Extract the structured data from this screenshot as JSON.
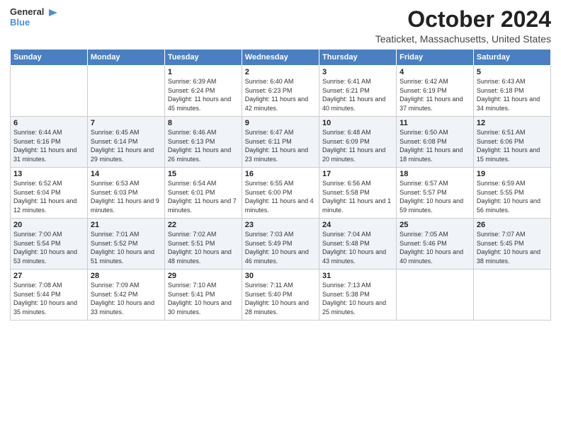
{
  "logo": {
    "line1": "General",
    "line2": "Blue"
  },
  "title": "October 2024",
  "location": "Teaticket, Massachusetts, United States",
  "headers": [
    "Sunday",
    "Monday",
    "Tuesday",
    "Wednesday",
    "Thursday",
    "Friday",
    "Saturday"
  ],
  "weeks": [
    [
      {
        "day": "",
        "info": ""
      },
      {
        "day": "",
        "info": ""
      },
      {
        "day": "1",
        "info": "Sunrise: 6:39 AM\nSunset: 6:24 PM\nDaylight: 11 hours and 45 minutes."
      },
      {
        "day": "2",
        "info": "Sunrise: 6:40 AM\nSunset: 6:23 PM\nDaylight: 11 hours and 42 minutes."
      },
      {
        "day": "3",
        "info": "Sunrise: 6:41 AM\nSunset: 6:21 PM\nDaylight: 11 hours and 40 minutes."
      },
      {
        "day": "4",
        "info": "Sunrise: 6:42 AM\nSunset: 6:19 PM\nDaylight: 11 hours and 37 minutes."
      },
      {
        "day": "5",
        "info": "Sunrise: 6:43 AM\nSunset: 6:18 PM\nDaylight: 11 hours and 34 minutes."
      }
    ],
    [
      {
        "day": "6",
        "info": "Sunrise: 6:44 AM\nSunset: 6:16 PM\nDaylight: 11 hours and 31 minutes."
      },
      {
        "day": "7",
        "info": "Sunrise: 6:45 AM\nSunset: 6:14 PM\nDaylight: 11 hours and 29 minutes."
      },
      {
        "day": "8",
        "info": "Sunrise: 6:46 AM\nSunset: 6:13 PM\nDaylight: 11 hours and 26 minutes."
      },
      {
        "day": "9",
        "info": "Sunrise: 6:47 AM\nSunset: 6:11 PM\nDaylight: 11 hours and 23 minutes."
      },
      {
        "day": "10",
        "info": "Sunrise: 6:48 AM\nSunset: 6:09 PM\nDaylight: 11 hours and 20 minutes."
      },
      {
        "day": "11",
        "info": "Sunrise: 6:50 AM\nSunset: 6:08 PM\nDaylight: 11 hours and 18 minutes."
      },
      {
        "day": "12",
        "info": "Sunrise: 6:51 AM\nSunset: 6:06 PM\nDaylight: 11 hours and 15 minutes."
      }
    ],
    [
      {
        "day": "13",
        "info": "Sunrise: 6:52 AM\nSunset: 6:04 PM\nDaylight: 11 hours and 12 minutes."
      },
      {
        "day": "14",
        "info": "Sunrise: 6:53 AM\nSunset: 6:03 PM\nDaylight: 11 hours and 9 minutes."
      },
      {
        "day": "15",
        "info": "Sunrise: 6:54 AM\nSunset: 6:01 PM\nDaylight: 11 hours and 7 minutes."
      },
      {
        "day": "16",
        "info": "Sunrise: 6:55 AM\nSunset: 6:00 PM\nDaylight: 11 hours and 4 minutes."
      },
      {
        "day": "17",
        "info": "Sunrise: 6:56 AM\nSunset: 5:58 PM\nDaylight: 11 hours and 1 minute."
      },
      {
        "day": "18",
        "info": "Sunrise: 6:57 AM\nSunset: 5:57 PM\nDaylight: 10 hours and 59 minutes."
      },
      {
        "day": "19",
        "info": "Sunrise: 6:59 AM\nSunset: 5:55 PM\nDaylight: 10 hours and 56 minutes."
      }
    ],
    [
      {
        "day": "20",
        "info": "Sunrise: 7:00 AM\nSunset: 5:54 PM\nDaylight: 10 hours and 53 minutes."
      },
      {
        "day": "21",
        "info": "Sunrise: 7:01 AM\nSunset: 5:52 PM\nDaylight: 10 hours and 51 minutes."
      },
      {
        "day": "22",
        "info": "Sunrise: 7:02 AM\nSunset: 5:51 PM\nDaylight: 10 hours and 48 minutes."
      },
      {
        "day": "23",
        "info": "Sunrise: 7:03 AM\nSunset: 5:49 PM\nDaylight: 10 hours and 46 minutes."
      },
      {
        "day": "24",
        "info": "Sunrise: 7:04 AM\nSunset: 5:48 PM\nDaylight: 10 hours and 43 minutes."
      },
      {
        "day": "25",
        "info": "Sunrise: 7:05 AM\nSunset: 5:46 PM\nDaylight: 10 hours and 40 minutes."
      },
      {
        "day": "26",
        "info": "Sunrise: 7:07 AM\nSunset: 5:45 PM\nDaylight: 10 hours and 38 minutes."
      }
    ],
    [
      {
        "day": "27",
        "info": "Sunrise: 7:08 AM\nSunset: 5:44 PM\nDaylight: 10 hours and 35 minutes."
      },
      {
        "day": "28",
        "info": "Sunrise: 7:09 AM\nSunset: 5:42 PM\nDaylight: 10 hours and 33 minutes."
      },
      {
        "day": "29",
        "info": "Sunrise: 7:10 AM\nSunset: 5:41 PM\nDaylight: 10 hours and 30 minutes."
      },
      {
        "day": "30",
        "info": "Sunrise: 7:11 AM\nSunset: 5:40 PM\nDaylight: 10 hours and 28 minutes."
      },
      {
        "day": "31",
        "info": "Sunrise: 7:13 AM\nSunset: 5:38 PM\nDaylight: 10 hours and 25 minutes."
      },
      {
        "day": "",
        "info": ""
      },
      {
        "day": "",
        "info": ""
      }
    ]
  ]
}
